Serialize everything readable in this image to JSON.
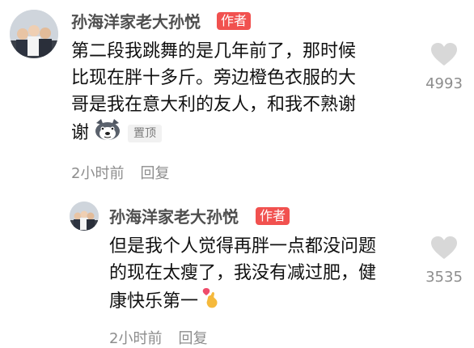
{
  "comments": [
    {
      "author": "孙海洋家老大孙悦",
      "author_tag": "作者",
      "lines": [
        "第二段我跳舞的是几年前了，那时候",
        "比现在胖十多斤。旁边橙色衣服的大",
        "哥是我在意大利的友人，和我不熟谢",
        "谢"
      ],
      "inline_emoji": "husky-emoji",
      "pin_label": "置顶",
      "time": "2小时前",
      "reply_label": "回复",
      "likes": "4993"
    },
    {
      "author": "孙海洋家老大孙悦",
      "author_tag": "作者",
      "lines": [
        "但是我个人觉得再胖一点都没问题",
        "的现在太瘦了，我没有减过肥，健",
        "康快乐第一"
      ],
      "inline_emoji": "finger-heart-emoji",
      "time": "2小时前",
      "reply_label": "回复",
      "likes": "3535"
    }
  ],
  "colors": {
    "author_tag_bg": "#f1514f",
    "like_icon": "#d8d8d8",
    "meta_text": "#8d8d8d"
  }
}
